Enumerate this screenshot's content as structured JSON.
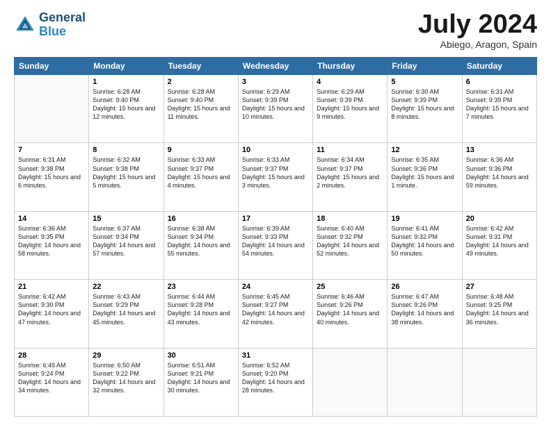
{
  "header": {
    "logo_line1": "General",
    "logo_line2": "Blue",
    "month": "July 2024",
    "location": "Abiego, Aragon, Spain"
  },
  "days_of_week": [
    "Sunday",
    "Monday",
    "Tuesday",
    "Wednesday",
    "Thursday",
    "Friday",
    "Saturday"
  ],
  "weeks": [
    [
      {
        "day": "",
        "empty": true
      },
      {
        "day": "1",
        "sunrise": "6:28 AM",
        "sunset": "9:40 PM",
        "daylight": "15 hours and 12 minutes."
      },
      {
        "day": "2",
        "sunrise": "6:28 AM",
        "sunset": "9:40 PM",
        "daylight": "15 hours and 11 minutes."
      },
      {
        "day": "3",
        "sunrise": "6:29 AM",
        "sunset": "9:39 PM",
        "daylight": "15 hours and 10 minutes."
      },
      {
        "day": "4",
        "sunrise": "6:29 AM",
        "sunset": "9:39 PM",
        "daylight": "15 hours and 9 minutes."
      },
      {
        "day": "5",
        "sunrise": "6:30 AM",
        "sunset": "9:39 PM",
        "daylight": "15 hours and 8 minutes."
      },
      {
        "day": "6",
        "sunrise": "6:31 AM",
        "sunset": "9:39 PM",
        "daylight": "15 hours and 7 minutes."
      }
    ],
    [
      {
        "day": "7",
        "sunrise": "6:31 AM",
        "sunset": "9:38 PM",
        "daylight": "15 hours and 6 minutes."
      },
      {
        "day": "8",
        "sunrise": "6:32 AM",
        "sunset": "9:38 PM",
        "daylight": "15 hours and 5 minutes."
      },
      {
        "day": "9",
        "sunrise": "6:33 AM",
        "sunset": "9:37 PM",
        "daylight": "15 hours and 4 minutes."
      },
      {
        "day": "10",
        "sunrise": "6:33 AM",
        "sunset": "9:37 PM",
        "daylight": "15 hours and 3 minutes."
      },
      {
        "day": "11",
        "sunrise": "6:34 AM",
        "sunset": "9:37 PM",
        "daylight": "15 hours and 2 minutes."
      },
      {
        "day": "12",
        "sunrise": "6:35 AM",
        "sunset": "9:36 PM",
        "daylight": "15 hours and 1 minute."
      },
      {
        "day": "13",
        "sunrise": "6:36 AM",
        "sunset": "9:36 PM",
        "daylight": "14 hours and 59 minutes."
      }
    ],
    [
      {
        "day": "14",
        "sunrise": "6:36 AM",
        "sunset": "9:35 PM",
        "daylight": "14 hours and 58 minutes."
      },
      {
        "day": "15",
        "sunrise": "6:37 AM",
        "sunset": "9:34 PM",
        "daylight": "14 hours and 57 minutes."
      },
      {
        "day": "16",
        "sunrise": "6:38 AM",
        "sunset": "9:34 PM",
        "daylight": "14 hours and 55 minutes."
      },
      {
        "day": "17",
        "sunrise": "6:39 AM",
        "sunset": "9:33 PM",
        "daylight": "14 hours and 54 minutes."
      },
      {
        "day": "18",
        "sunrise": "6:40 AM",
        "sunset": "9:32 PM",
        "daylight": "14 hours and 52 minutes."
      },
      {
        "day": "19",
        "sunrise": "6:41 AM",
        "sunset": "9:32 PM",
        "daylight": "14 hours and 50 minutes."
      },
      {
        "day": "20",
        "sunrise": "6:42 AM",
        "sunset": "9:31 PM",
        "daylight": "14 hours and 49 minutes."
      }
    ],
    [
      {
        "day": "21",
        "sunrise": "6:42 AM",
        "sunset": "9:30 PM",
        "daylight": "14 hours and 47 minutes."
      },
      {
        "day": "22",
        "sunrise": "6:43 AM",
        "sunset": "9:29 PM",
        "daylight": "14 hours and 45 minutes."
      },
      {
        "day": "23",
        "sunrise": "6:44 AM",
        "sunset": "9:28 PM",
        "daylight": "14 hours and 43 minutes."
      },
      {
        "day": "24",
        "sunrise": "6:45 AM",
        "sunset": "9:27 PM",
        "daylight": "14 hours and 42 minutes."
      },
      {
        "day": "25",
        "sunrise": "6:46 AM",
        "sunset": "9:26 PM",
        "daylight": "14 hours and 40 minutes."
      },
      {
        "day": "26",
        "sunrise": "6:47 AM",
        "sunset": "9:26 PM",
        "daylight": "14 hours and 38 minutes."
      },
      {
        "day": "27",
        "sunrise": "6:48 AM",
        "sunset": "9:25 PM",
        "daylight": "14 hours and 36 minutes."
      }
    ],
    [
      {
        "day": "28",
        "sunrise": "6:49 AM",
        "sunset": "9:24 PM",
        "daylight": "14 hours and 34 minutes."
      },
      {
        "day": "29",
        "sunrise": "6:50 AM",
        "sunset": "9:22 PM",
        "daylight": "14 hours and 32 minutes."
      },
      {
        "day": "30",
        "sunrise": "6:51 AM",
        "sunset": "9:21 PM",
        "daylight": "14 hours and 30 minutes."
      },
      {
        "day": "31",
        "sunrise": "6:52 AM",
        "sunset": "9:20 PM",
        "daylight": "14 hours and 28 minutes."
      },
      {
        "day": "",
        "empty": true
      },
      {
        "day": "",
        "empty": true
      },
      {
        "day": "",
        "empty": true
      }
    ]
  ]
}
